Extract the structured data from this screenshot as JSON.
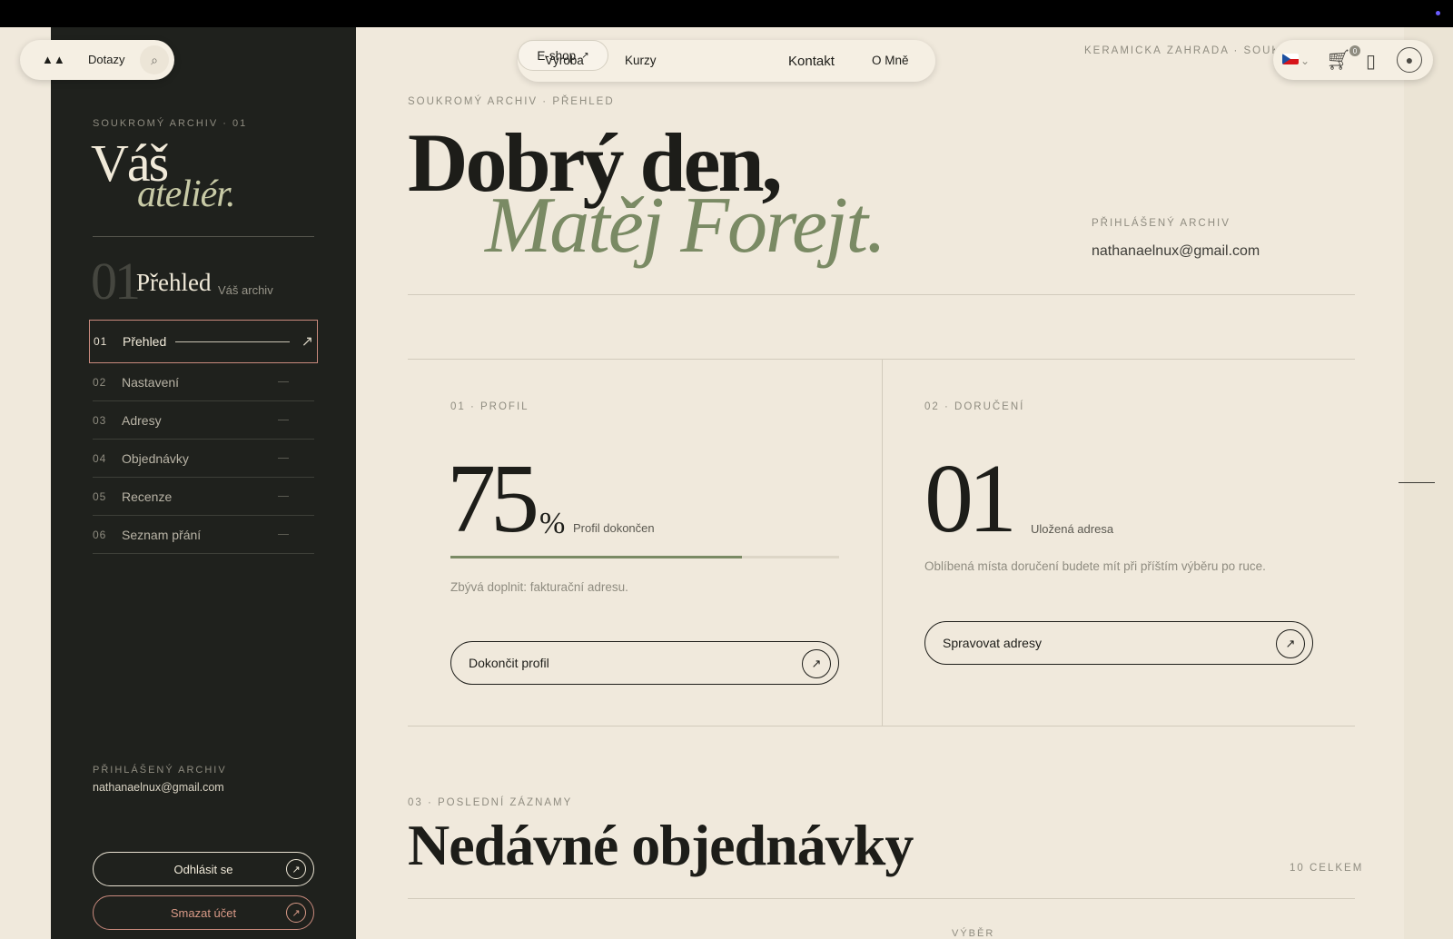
{
  "sidebar": {
    "kicker": "SOUKROMÝ ARCHIV · 01",
    "title_line1": "Váš",
    "title_line2": "ateliér.",
    "section_number": "01",
    "section_title": "Přehled",
    "section_subtitle": "Váš archiv",
    "items": [
      {
        "num": "01",
        "label": "Přehled",
        "active": true
      },
      {
        "num": "02",
        "label": "Nastavení"
      },
      {
        "num": "03",
        "label": "Adresy"
      },
      {
        "num": "04",
        "label": "Objednávky"
      },
      {
        "num": "05",
        "label": "Recenze"
      },
      {
        "num": "06",
        "label": "Seznam přání"
      }
    ],
    "footer_kicker": "PŘIHLÁŠENÝ ARCHIV",
    "footer_email": "nathanaelnux@gmail.com",
    "logout_label": "Odhlásit se",
    "delete_label": "Smazat účet"
  },
  "header": {
    "faq_label": "Dotazy",
    "nav": [
      "Výroba",
      "Kurzy",
      "E-shop",
      "Kontakt",
      "O Mně"
    ],
    "shop_arrow": "↗",
    "breadcrumb_top": "KERAMICKÁ ZAHRADA · SOUKROMÝ ARCHIV",
    "cart_count": "0"
  },
  "main": {
    "kicker": "SOUKROMÝ ARCHIV · PŘEHLED",
    "greeting": "Dobrý den,",
    "name": "Matěj Forejt.",
    "account_kicker": "PŘIHLÁŠENÝ ARCHIV",
    "account_email": "nathanaelnux@gmail.com",
    "profile": {
      "kicker": "01 · PROFIL",
      "value": "75",
      "unit": "%",
      "label": "Profil dokončen",
      "progress": 0.75,
      "note": "Zbývá doplnit: fakturační adresu.",
      "cta": "Dokončit profil"
    },
    "delivery": {
      "kicker": "02 · DORUČENÍ",
      "value": "01",
      "label": "Uložená adresa",
      "note": "Oblíbená místa doručení budete mít při příštím výběru po ruce.",
      "cta": "Spravovat adresy"
    },
    "recent": {
      "kicker": "03 · POSLEDNÍ ZÁZNAMY",
      "title": "Nedávné objednávky",
      "total": "10 CELKEM",
      "column_kicker": "VÝBĚR"
    }
  },
  "colors": {
    "sidebar_bg": "#1f211d",
    "page_bg": "#f0e9dc",
    "accent_green": "#7a8a64",
    "accent_rose": "#c98a7d"
  },
  "icons": [
    "logo-icon",
    "search-icon",
    "arrow-up-right-icon",
    "flag-cz-icon",
    "cart-icon",
    "bookmark-icon",
    "user-icon"
  ]
}
